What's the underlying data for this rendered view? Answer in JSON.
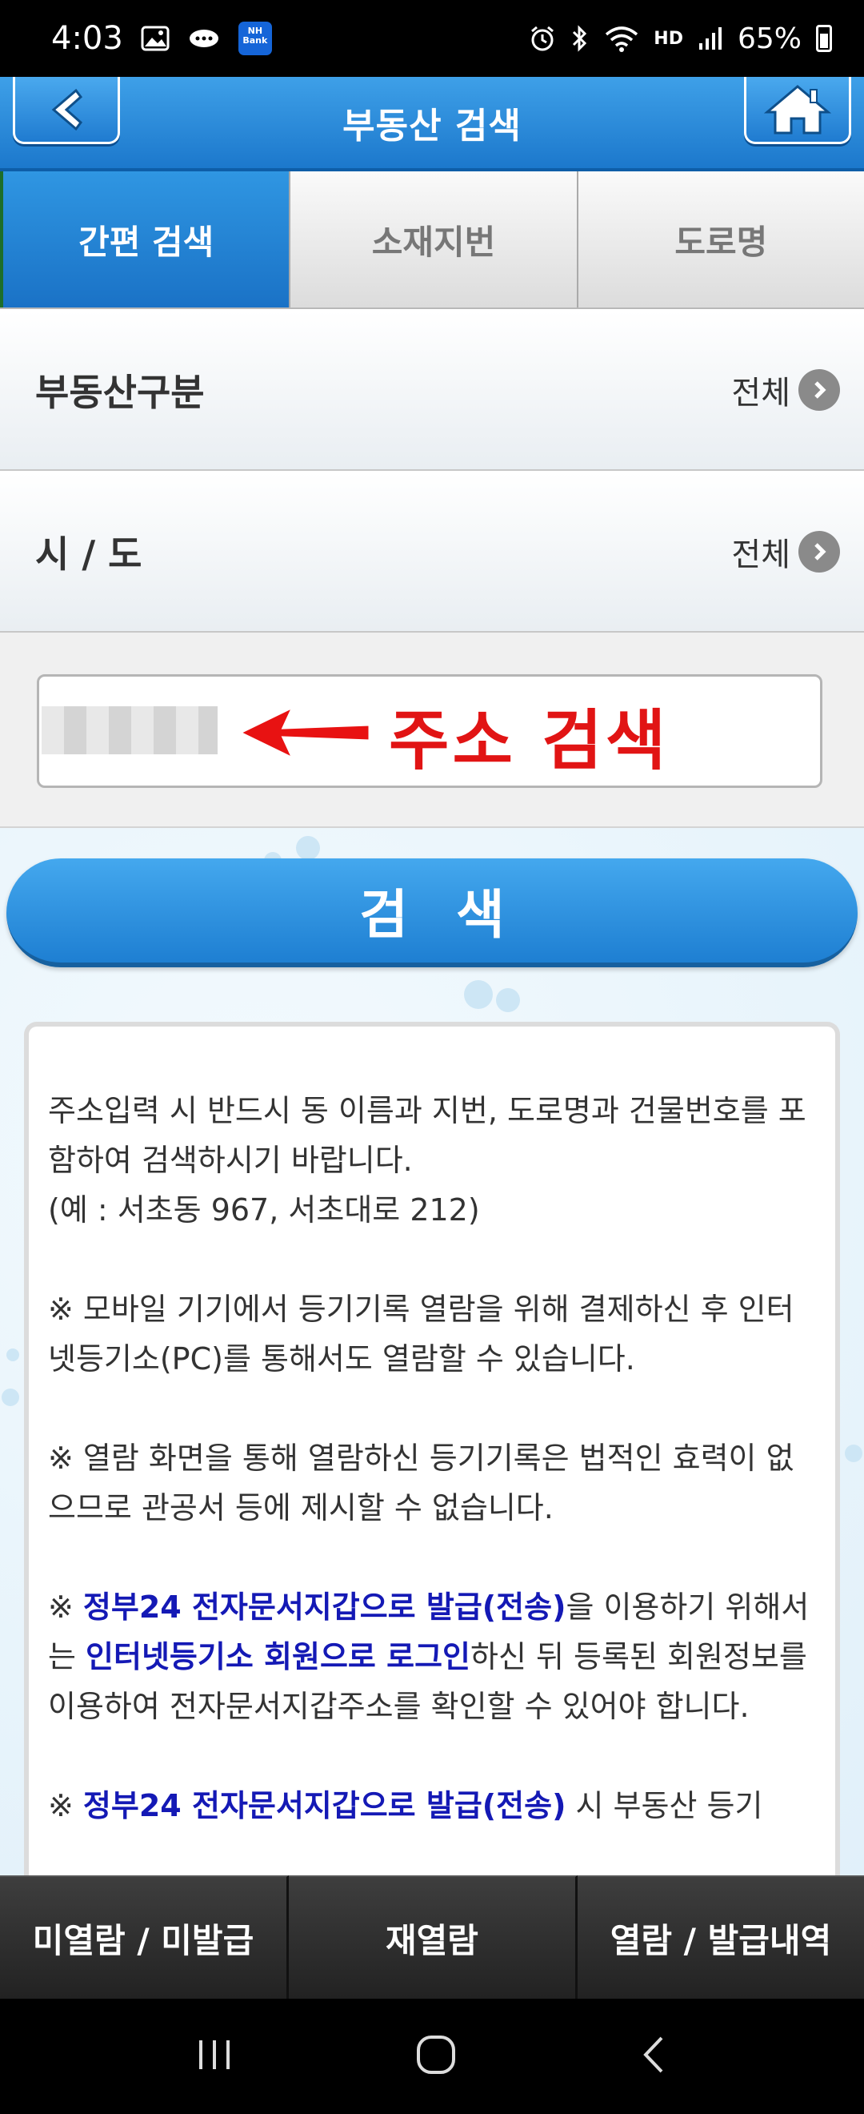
{
  "status_bar": {
    "time": "4:03",
    "nh_badge": "NH\nBank",
    "hd_label": "HD",
    "battery": "65%"
  },
  "header": {
    "title": "부동산 검색"
  },
  "tabs": [
    {
      "label": "간편 검색",
      "active": true
    },
    {
      "label": "소재지번",
      "active": false
    },
    {
      "label": "도로명",
      "active": false
    }
  ],
  "options": {
    "property_type": {
      "label": "부동산구분",
      "value": "전체"
    },
    "region": {
      "label": "시 / 도",
      "value": "전체"
    }
  },
  "search": {
    "annotation": "주소 검색",
    "button_label": "검색"
  },
  "info": {
    "p1": "주소입력 시 반드시 동 이름과 지번, 도로명과 건물번호를 포함하여 검색하시기 바랍니다.",
    "p1_example": "(예 : 서초동 967, 서초대로 212)",
    "p2": "※ 모바일 기기에서 등기기록 열람을 위해 결제하신 후 인터넷등기소(PC)를 통해서도 열람할 수 있습니다.",
    "p3": "※ 열람 화면을 통해 열람하신 등기기록은 법적인 효력이 없으므로 관공서 등에 제시할 수 없습니다.",
    "p4_prefix": "※ ",
    "p4_hl1": "정부24 전자문서지갑으로 발급(전송)",
    "p4_mid1": "을 이용하기 위해서는 ",
    "p4_hl2": "인터넷등기소 회원으로 로그인",
    "p4_mid2": "하신 뒤 등록된 회원정보를 이용하여 전자문서지갑주소를 확인할 수 있어야 합니다.",
    "p5_prefix": "※ ",
    "p5_hl1": "정부24 전자문서지갑으로 발급(전송)",
    "p5_rest": " 시 부동산 등기"
  },
  "bottom_tabs": [
    {
      "label": "미열람 / 미발급"
    },
    {
      "label": "재열람"
    },
    {
      "label": "열람 / 발급내역"
    }
  ]
}
